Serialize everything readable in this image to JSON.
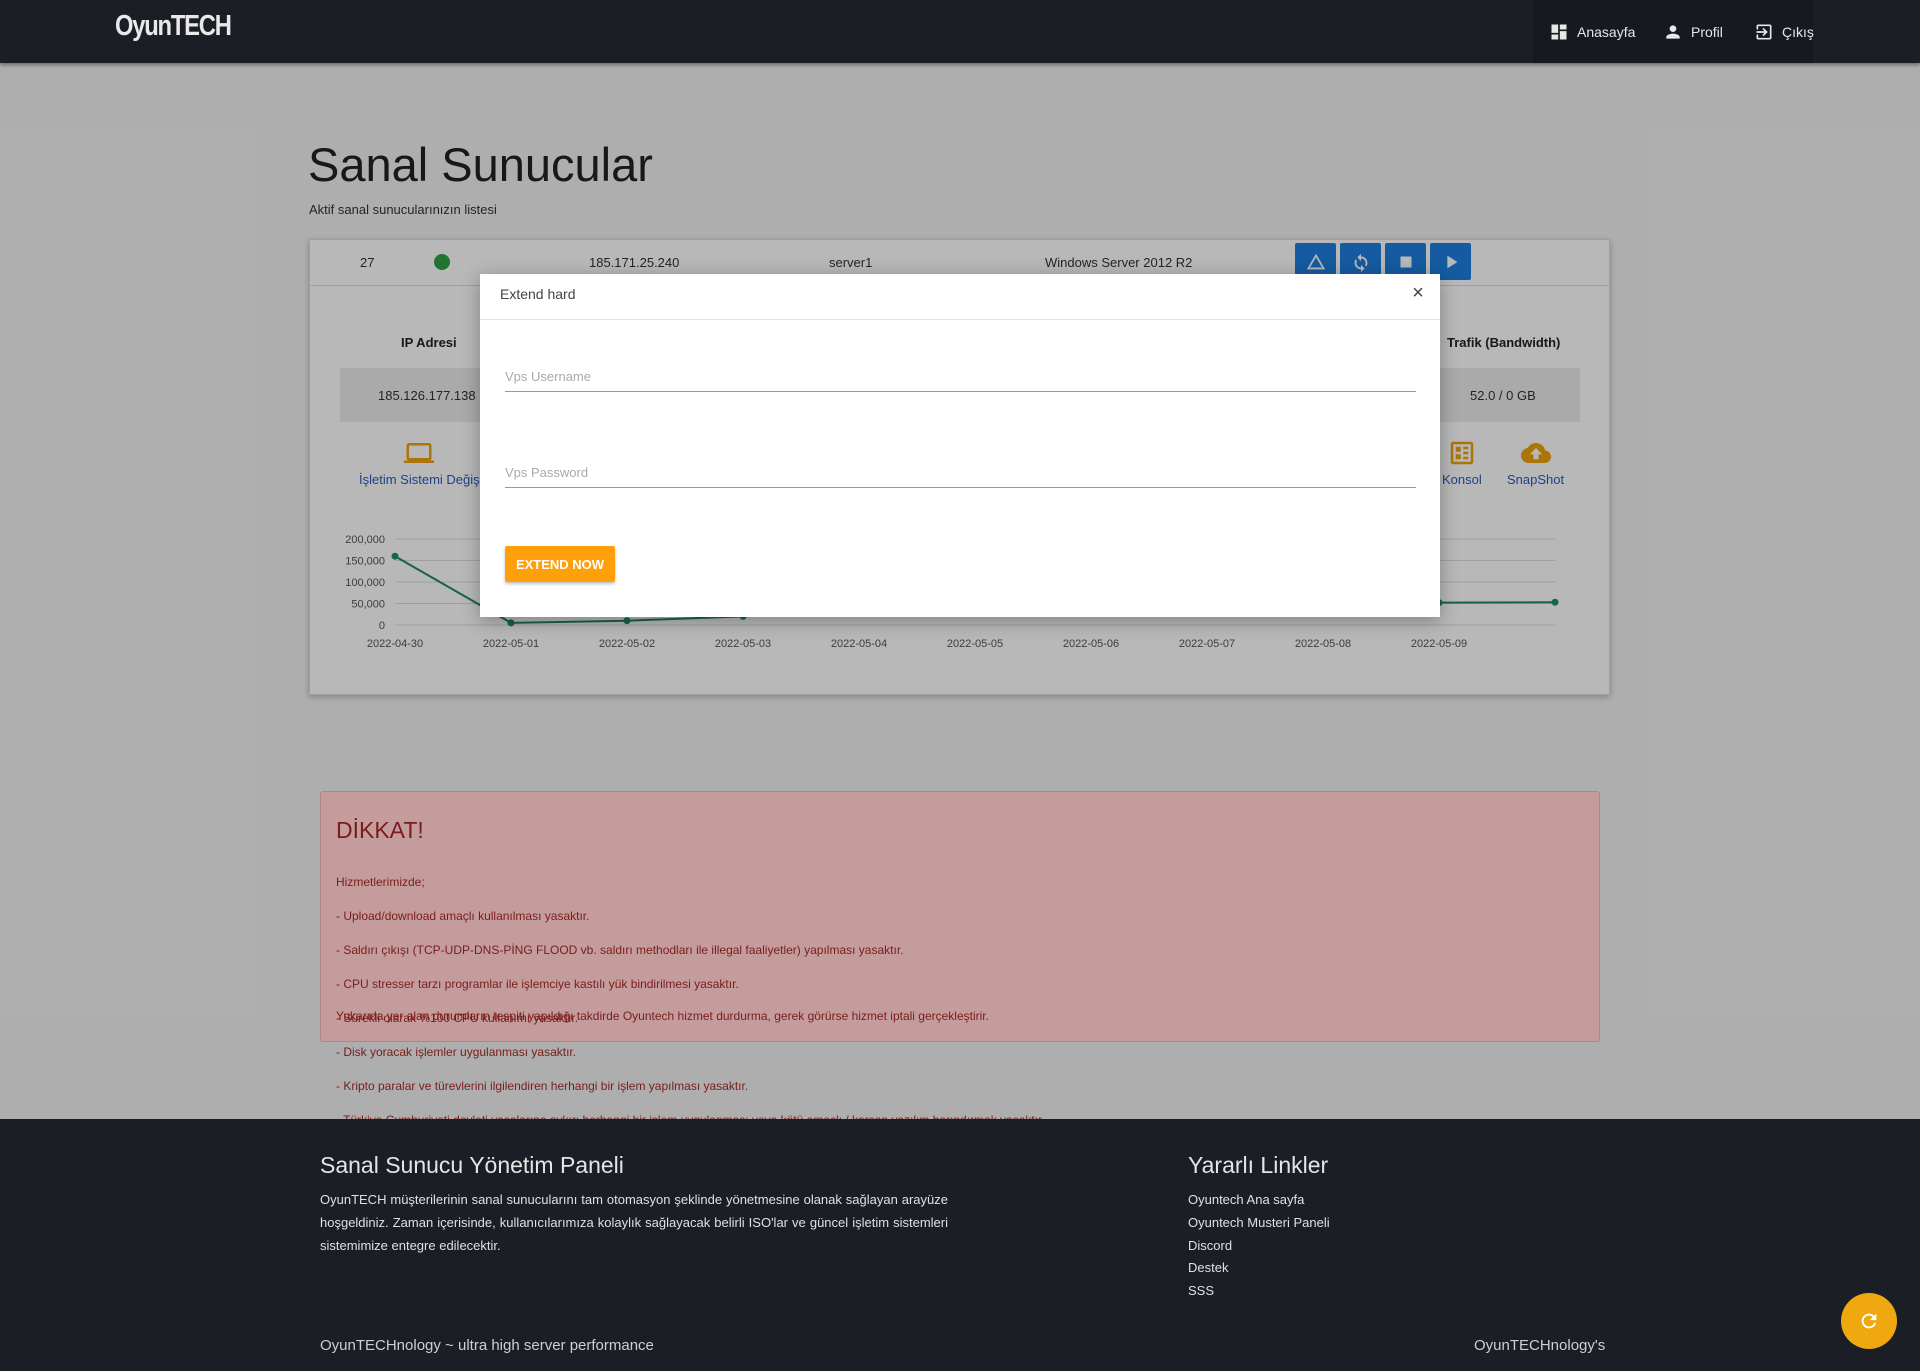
{
  "nav": {
    "brand": "OyunTECH",
    "items": [
      {
        "label": "Anasayfa",
        "icon": "dashboard-icon"
      },
      {
        "label": "Profil",
        "icon": "person-icon"
      },
      {
        "label": "Çıkış",
        "icon": "logout-icon"
      }
    ]
  },
  "page": {
    "title": "Sanal Sunucular",
    "subtitle": "Aktif sanal sunucularınızın listesi"
  },
  "server_row": {
    "id": "27",
    "status_color": "#2ea043",
    "ip": "185.171.25.240",
    "name": "server1",
    "os": "Windows Server 2012 R2",
    "actions": [
      "warning-icon",
      "restart-icon",
      "stop-icon",
      "play-icon"
    ]
  },
  "details": {
    "headers": {
      "ip": "IP Adresi",
      "traffic": "Trafik (Bandwidth)"
    },
    "values": {
      "ip": "185.126.177.138",
      "traffic": "52.0 / 0 GB"
    },
    "tools": [
      {
        "label": "İşletim Sistemi Değiş",
        "icon": "laptop-icon"
      },
      {
        "label": "Konsol",
        "icon": "console-icon"
      },
      {
        "label": "SnapShot",
        "icon": "cloud-upload-icon"
      }
    ]
  },
  "chart_data": {
    "type": "line",
    "x": [
      "2022-04-30",
      "2022-05-01",
      "2022-05-02",
      "2022-05-03",
      "2022-05-04",
      "2022-05-05",
      "2022-05-06",
      "2022-05-07",
      "2022-05-08",
      "2022-05-09",
      "2022-05-10"
    ],
    "x_ticks": [
      "2022-04-30",
      "2022-05-01",
      "2022-05-02",
      "2022-05-03",
      "2022-05-04",
      "2022-05-05",
      "2022-05-06",
      "2022-05-07",
      "2022-05-08",
      "2022-05-09"
    ],
    "visible_points": [
      {
        "x": "2022-04-30",
        "y": 160000
      },
      {
        "x": "2022-05-01",
        "y": 5000
      },
      {
        "x": "2022-05-02",
        "y": 10000
      },
      {
        "x": "2022-05-03",
        "y": 20000
      },
      {
        "x": "2022-05-09",
        "y": 52000
      },
      {
        "x": "2022-05-10",
        "y": 53000
      }
    ],
    "y_ticks": [
      "200,000",
      "150,000",
      "100,000",
      "50,000",
      "0"
    ],
    "ylim": [
      0,
      200000
    ],
    "color": "#1f8a6e",
    "grid": true
  },
  "modal": {
    "title": "Extend hard",
    "close": "×",
    "username_placeholder": "Vps Username",
    "password_placeholder": "Vps Password",
    "button": "EXTEND NOW"
  },
  "alert": {
    "title": "DİKKAT!",
    "lines": [
      "Hizmetlerimizde;",
      "- Upload/download amaçlı kullanılması yasaktır.",
      "- Saldırı çıkışı (TCP-UDP-DNS-PİNG FLOOD vb. saldırı methodları ile illegal faaliyetler) yapılması yasaktır.",
      "- CPU stresser tarzı programlar ile işlemciye kastılı yük bindirilmesi yasaktır.",
      "- Sürekli olarak %100 CPU kullanımı yasaktır.",
      "- Disk yoracak işlemler uygulanması yasaktır.",
      "- Kripto paralar ve türevlerini ilgilendiren herhangi bir işlem yapılması yasaktır.",
      "- Türkiye Cumhuriyeti devleti yasalarına aykırı herhangi bir işlem uygulanması veya kötü amaçlı / korsan yazılım barındırmak yasaktır."
    ],
    "footer": "Yukarıda yer alan durumların tespiti yapıldığı takdirde Oyuntech hizmet durdurma, gerek görürse hizmet iptali gerçekleştirir."
  },
  "footer": {
    "panel_title": "Sanal Sunucu Yönetim Paneli",
    "panel_desc": "OyunTECH müşterilerinin sanal sunucularını tam otomasyon şeklinde yönetmesine olanak sağlayan arayüze hoşgeldiniz. Zaman içerisinde, kullanıcılarımıza kolaylık sağlayacak belirli ISO'lar ve güncel işletim sistemleri sistemimize entegre edilecektir.",
    "links_title": "Yararlı Linkler",
    "links": [
      "Oyuntech Ana sayfa",
      "Oyuntech Musteri Paneli",
      "Discord",
      "Destek",
      "SSS"
    ],
    "bottom_left": "OyunTECHnology ~ ultra high server performance",
    "bottom_right": "OyunTECHnology's"
  }
}
